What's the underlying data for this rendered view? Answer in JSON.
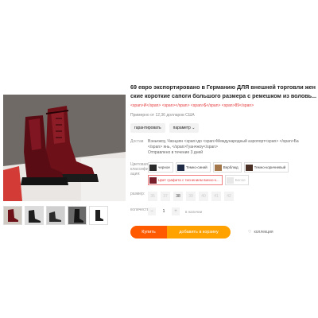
{
  "product": {
    "title_line1": "69 евро экспортировано в Германию ДЛЯ внешней торговли жен",
    "title_line2": "ские короткие сапоги большого размера с ремешком из воловь...",
    "subtitle": "<span>И</span> <span></span> <span>$</span> <span>89</span>",
    "price_text": "Примерно от 12,36 долларов США",
    "guarantee_label": "гарантировать",
    "params_label": "параметр",
    "shipping_label": "Достав",
    "shipping_line1": "Вэньчжоу, Чжэцзян <span>до          <span>Международный аэропорт<span> </span>Ба",
    "shipping_line2": "</span>                       янь, </span>Гуанчжоу</span>",
    "shipping_line3": "Отправлено в течение 3 дней",
    "color_label": "Цветовая классифик ация:",
    "colors": [
      {
        "name": "черное",
        "color": "#2a2a2a"
      },
      {
        "name": "Темно-синий",
        "color": "#1f2a44"
      },
      {
        "name": "Верблюд",
        "color": "#a3774a"
      },
      {
        "name": "Темно-коричневый",
        "color": "#4a3024"
      },
      {
        "name": "Цвет графита с тиснением винно-к...",
        "color": "#7a1d2a"
      },
      {
        "name": "Белое",
        "color": "#e8e8e8"
      }
    ],
    "size_label": "размер:",
    "sizes": [
      "35",
      "37",
      "38",
      "39",
      "40",
      "41",
      "42"
    ],
    "qty_label": "количество:",
    "quantity": "1",
    "stock": "в наличии",
    "buy_label": "Купить",
    "cart_label": "добавить в корзину",
    "fav_label": "коллекция"
  }
}
